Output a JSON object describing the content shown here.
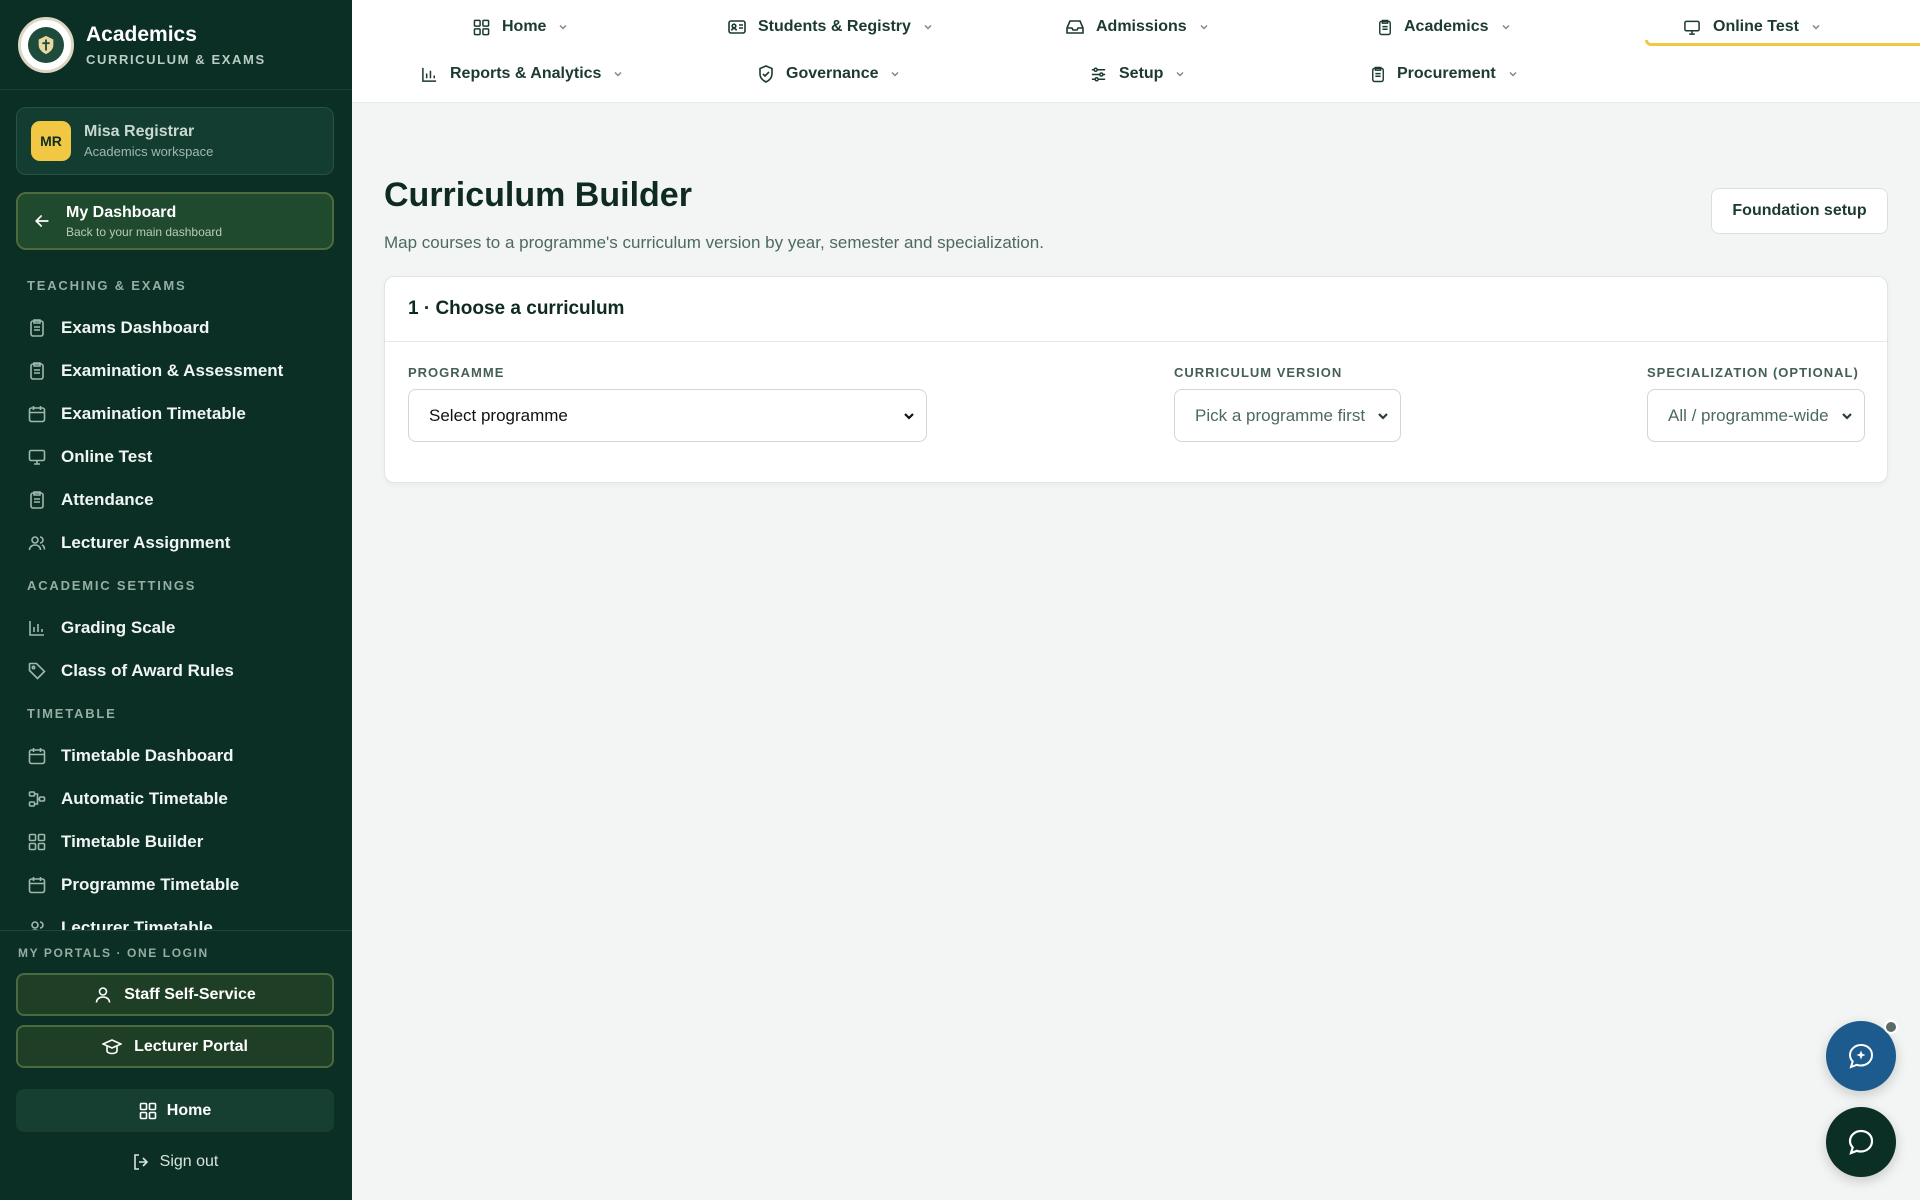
{
  "brand": {
    "title": "Academics",
    "subtitle": "CURRICULUM & EXAMS",
    "logo_icon": "crest-logo"
  },
  "user": {
    "initials": "MR",
    "name": "Misa Registrar",
    "workspace": "Academics workspace"
  },
  "dashboard": {
    "title": "My Dashboard",
    "subtitle": "Back to your main dashboard"
  },
  "sidebar": {
    "sections": [
      {
        "label": "TEACHING & EXAMS",
        "items": [
          {
            "label": "Exams Dashboard",
            "icon": "clipboard-icon"
          },
          {
            "label": "Examination & Assessment",
            "icon": "clipboard-icon"
          },
          {
            "label": "Examination Timetable",
            "icon": "calendar-icon"
          },
          {
            "label": "Online Test",
            "icon": "monitor-icon"
          },
          {
            "label": "Attendance",
            "icon": "clipboard-icon"
          },
          {
            "label": "Lecturer Assignment",
            "icon": "users-icon"
          }
        ]
      },
      {
        "label": "ACADEMIC SETTINGS",
        "items": [
          {
            "label": "Grading Scale",
            "icon": "bar-chart-icon"
          },
          {
            "label": "Class of Award Rules",
            "icon": "tag-icon"
          }
        ]
      },
      {
        "label": "TIMETABLE",
        "items": [
          {
            "label": "Timetable Dashboard",
            "icon": "calendar-icon"
          },
          {
            "label": "Automatic Timetable",
            "icon": "workflow-icon"
          },
          {
            "label": "Timetable Builder",
            "icon": "grid-icon"
          },
          {
            "label": "Programme Timetable",
            "icon": "calendar-icon"
          },
          {
            "label": "Lecturer Timetable",
            "icon": "users-icon"
          }
        ]
      }
    ]
  },
  "portals": {
    "label": "MY PORTALS · ONE LOGIN",
    "staff": "Staff Self-Service",
    "lecturer": "Lecturer Portal",
    "home": "Home",
    "signout": "Sign out"
  },
  "topnav": {
    "row1": [
      "Home",
      "Students & Registry",
      "Admissions",
      "Academics",
      "Online Test"
    ],
    "row2": [
      "Reports & Analytics",
      "Governance",
      "Setup",
      "Procurement"
    ],
    "active": "Academics",
    "accent_color": "#f2c744"
  },
  "page": {
    "title": "Curriculum Builder",
    "subtitle": "Map courses to a programme's curriculum version by year, semester and specialization.",
    "foundation_button": "Foundation setup"
  },
  "card": {
    "title": "1 · Choose a curriculum",
    "programme": {
      "label": "PROGRAMME",
      "value": "Select programme"
    },
    "version": {
      "label": "CURRICULUM VERSION",
      "value": "Pick a programme first"
    },
    "specialization": {
      "label": "SPECIALIZATION (OPTIONAL)",
      "value": "All / programme-wide"
    }
  },
  "colors": {
    "sidebar_bg": "#0b2f24",
    "fab_ai": "#1d5b8f",
    "fab_chat": "#0b2f24"
  }
}
